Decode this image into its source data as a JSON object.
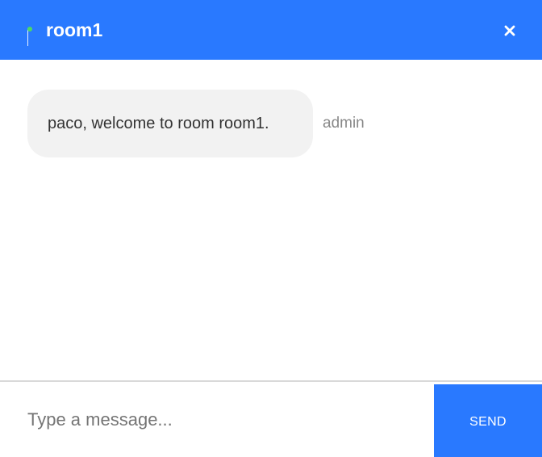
{
  "header": {
    "room_name": "room1",
    "status_icon": "online-flag-icon",
    "close_icon": "close-icon",
    "accent_color": "#2979ff",
    "status_color": "#4cd964"
  },
  "messages": [
    {
      "text": "paco, welcome to room room1.",
      "sender": "admin"
    }
  ],
  "composer": {
    "placeholder": "Type a message...",
    "value": "",
    "send_label": "SEND"
  }
}
